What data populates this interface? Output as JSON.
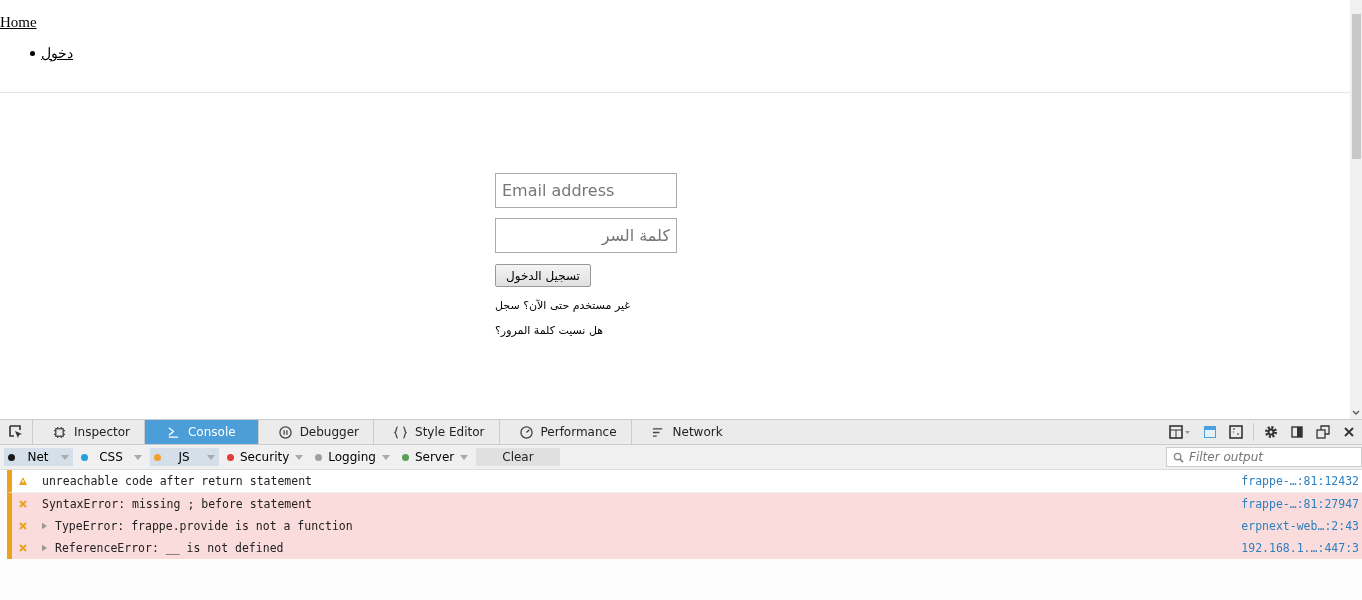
{
  "page": {
    "home_link": "Home",
    "nav_items": [
      "دخول"
    ],
    "login": {
      "email_placeholder": "Email address",
      "password_placeholder": "كلمة السر",
      "submit": "تسجيل الدخول",
      "signup_link": "غير مستخدم حتى الآن؟ سجل",
      "forgot_link": "هل نسيت كلمة المرور؟"
    }
  },
  "devtools": {
    "tabs": [
      {
        "label": "Inspector",
        "selected": false
      },
      {
        "label": "Console",
        "selected": true
      },
      {
        "label": "Debugger",
        "selected": false
      },
      {
        "label": "Style Editor",
        "selected": false
      },
      {
        "label": "Performance",
        "selected": false
      },
      {
        "label": "Network",
        "selected": false
      }
    ],
    "filters": [
      {
        "label": "Net",
        "color": "#1a1a1a",
        "selected": true
      },
      {
        "label": "CSS",
        "color": "#1fa2d8",
        "selected": false
      },
      {
        "label": "JS",
        "color": "#f0a02a",
        "selected": true
      },
      {
        "label": "Security",
        "color": "#e03c3c",
        "selected": false
      },
      {
        "label": "Logging",
        "color": "#a0a0a0",
        "selected": false
      },
      {
        "label": "Server",
        "color": "#5aa05a",
        "selected": false
      }
    ],
    "clear": "Clear",
    "filter_placeholder": "Filter output",
    "messages": [
      {
        "kind": "warning",
        "expandable": false,
        "text": "unreachable code after return statement",
        "source": "frappe-…:81:12432"
      },
      {
        "kind": "error",
        "expandable": false,
        "text": "SyntaxError: missing ; before statement",
        "source": "frappe-…:81:27947"
      },
      {
        "kind": "error",
        "expandable": true,
        "text": "TypeError: frappe.provide is not a function",
        "source": "erpnext-web…:2:43"
      },
      {
        "kind": "error",
        "expandable": true,
        "text": "ReferenceError: __ is not defined",
        "source": "192.168.1.…:447:3"
      }
    ]
  }
}
